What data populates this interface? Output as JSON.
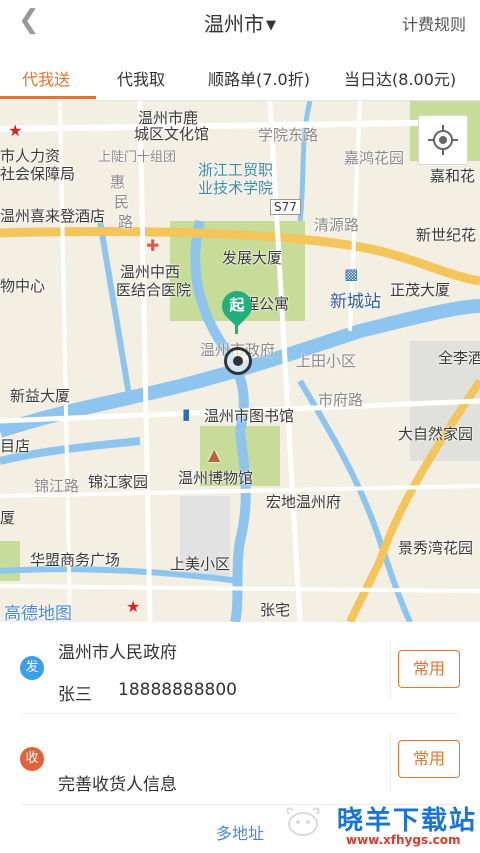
{
  "header": {
    "back_icon": "chevron-left-icon",
    "city": "温州市",
    "city_caret_icon": "caret-down-icon",
    "rules": "计费规则"
  },
  "tabs": [
    {
      "label": "代我送"
    },
    {
      "label": "代我取"
    },
    {
      "label": "顺路单(7.0折)"
    },
    {
      "label": "当日达(8.00元)"
    }
  ],
  "map": {
    "start_pin": "起",
    "labels": {
      "wenzhou_wenhuaguan": "温州市鹿\n城区文化馆",
      "xueyuan_donglu": "学院东路",
      "shangdianmen": "上陡门十组团",
      "renli": "市人力资",
      "shebao": "社会保障局",
      "jiahong": "嘉鸿花园",
      "jiahe": "嘉和花",
      "zhejiang_college": "浙江工贸职\n业技术学院",
      "huimin": "惠\n民\n路",
      "s77": "S77",
      "xilaideng": "温州喜来登酒店",
      "qingyuan": "清源路",
      "xinshiji": "新世纪花",
      "hospital": "温州中西\n医结合医院",
      "fazhan": "发展大厦",
      "wuzhongxin": "物中心",
      "gongyu": "程公寓",
      "xincheng_station": "新城站",
      "zhengguang": "正茂大厦",
      "government": "温州市政府",
      "shangtian": "上田小区",
      "quanli": "全李酒",
      "xinyi": "新益大厦",
      "shifu_road": "市府路",
      "library": "温州市图书馆",
      "daziran": "大自然家园",
      "jiangdian": "目店",
      "jinjiang_road": "锦江路",
      "jinjiang_home": "锦江家园",
      "museum": "温州博物馆",
      "hongdi": "宏地温州府",
      "xiasha": "厦",
      "huameng": "华盟商务广场",
      "jingxiu": "景秀湾花园",
      "shangmei": "上美小区",
      "gaode": "高德地图",
      "zhangzhai": "张宅"
    }
  },
  "sender": {
    "badge": "发",
    "address": "温州市人民政府",
    "name": "张三",
    "phone": "18888888800",
    "button": "常用"
  },
  "receiver": {
    "badge": "收",
    "placeholder": "完善收货人信息",
    "button": "常用"
  },
  "multi_address": "多地址",
  "watermark": {
    "title": "晓羊下载站",
    "url": "www.xfhygs.com"
  },
  "colors": {
    "accent": "#e8732e",
    "pin": "#22b07a",
    "send_badge": "#3aa0e6",
    "recv_badge": "#e2623a",
    "water": "#8ec5ef",
    "park": "#c8dc9a",
    "road": "#f3c55a"
  }
}
